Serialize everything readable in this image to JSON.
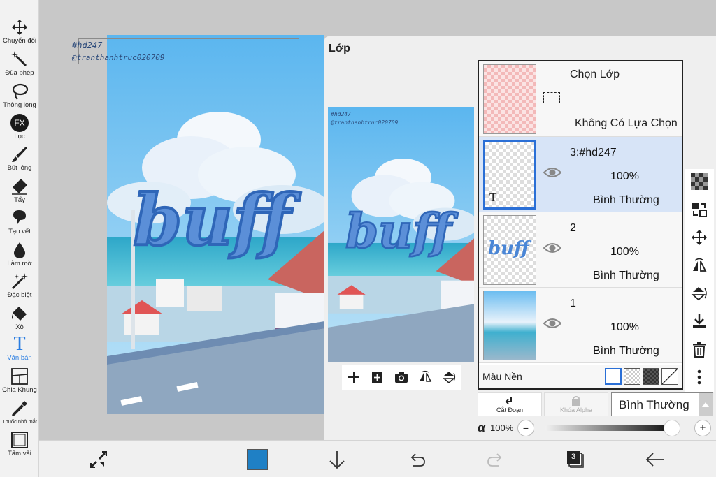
{
  "tools": [
    {
      "label": "Chuyển đổi",
      "icon": "move-icon"
    },
    {
      "label": "Đũa phép",
      "icon": "magic-wand-icon"
    },
    {
      "label": "Thòng lọng",
      "icon": "lasso-icon"
    },
    {
      "label": "Lọc",
      "icon": "fx-icon",
      "icon_text": "FX"
    },
    {
      "label": "Bút lông",
      "icon": "brush-icon"
    },
    {
      "label": "Tẩy",
      "icon": "eraser-icon"
    },
    {
      "label": "Tạo vết",
      "icon": "smudge-icon"
    },
    {
      "label": "Làm mờ",
      "icon": "blur-icon"
    },
    {
      "label": "Đặc biệt",
      "icon": "special-icon"
    },
    {
      "label": "Xô",
      "icon": "bucket-icon"
    },
    {
      "label": "Văn bản",
      "icon": "text-icon",
      "active": true,
      "icon_text": "T"
    },
    {
      "label": "Chia Khung",
      "icon": "frame-divider-icon"
    },
    {
      "label": "Thuốc nhỏ mắt",
      "icon": "eyedropper-icon"
    },
    {
      "label": "Tấm vải",
      "icon": "canvas-icon"
    }
  ],
  "canvas": {
    "watermark_tag": "#hd247",
    "watermark_handle": "@tranthanhtruc020709",
    "art_text": "buff"
  },
  "panel": {
    "title": "Lớp",
    "selection_row": {
      "title": "Chọn Lớp",
      "status": "Không Có Lựa Chọn"
    },
    "layers": [
      {
        "name": "3:#hd247",
        "opacity": "100%",
        "blend": "Bình Thường",
        "selected": true,
        "type_mark": "T"
      },
      {
        "name": "2",
        "opacity": "100%",
        "blend": "Bình Thường",
        "selected": false,
        "thumb_text": "buff"
      },
      {
        "name": "1",
        "opacity": "100%",
        "blend": "Bình Thường",
        "selected": false
      }
    ],
    "background": {
      "label": "Màu Nền"
    },
    "clip_button": "Cắt Đoạn",
    "alpha_lock_button": "Khóa Alpha",
    "blend_mode": "Bình Thường",
    "alpha_symbol": "α",
    "alpha_value": "100%",
    "alpha_minus": "−",
    "alpha_plus": "+"
  },
  "bottom": {
    "layer_count": "3",
    "color": "#1f80c5"
  },
  "colors": {
    "accent": "#2a7de1",
    "selected_layer_bg": "#d7e4f7",
    "primary_color": "#1f80c5"
  }
}
